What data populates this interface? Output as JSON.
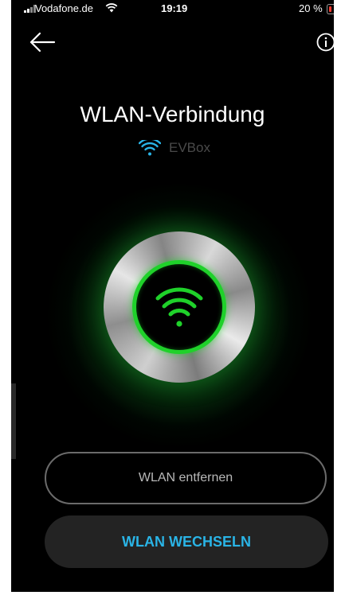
{
  "status_bar": {
    "carrier": "Vodafone.de",
    "time": "19:19",
    "battery": "20 %",
    "icons": [
      "signal-icon",
      "wifi-icon",
      "battery-low-icon"
    ]
  },
  "header": {
    "back_icon": "arrow-left-icon",
    "info_icon": "info-circle-icon"
  },
  "page": {
    "title": "WLAN-Verbindung",
    "network_icon": "wifi-icon",
    "network_name": "EVBox"
  },
  "status_ring": {
    "icon": "wifi-icon",
    "color": "#1fd12a"
  },
  "actions": {
    "remove_label": "WLAN entfernen",
    "change_label": "WLAN WECHSELN"
  },
  "colors": {
    "background": "#000000",
    "accent_blue": "#2ab4e6",
    "accent_green": "#1fd12a",
    "battery_low": "#ff3b30"
  }
}
